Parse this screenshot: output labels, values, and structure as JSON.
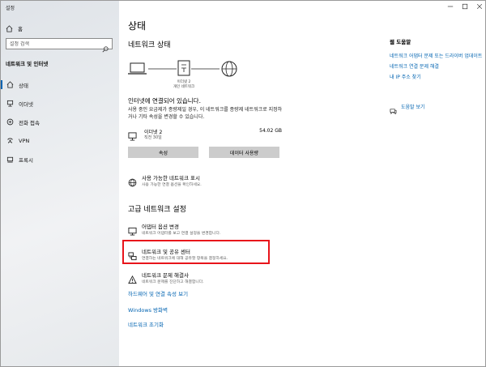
{
  "app": {
    "title": "설정"
  },
  "sidebar": {
    "home_label": "홈",
    "search_placeholder": "설정 검색",
    "section_title": "네트워크 및 인터넷",
    "items": [
      {
        "label": "상태",
        "icon": "home-network-icon",
        "active": true
      },
      {
        "label": "이더넷",
        "icon": "ethernet-icon",
        "active": false
      },
      {
        "label": "전화 접속",
        "icon": "dialup-icon",
        "active": false
      },
      {
        "label": "VPN",
        "icon": "vpn-icon",
        "active": false
      },
      {
        "label": "프록시",
        "icon": "proxy-icon",
        "active": false
      }
    ]
  },
  "main": {
    "title": "상태",
    "network_status_heading": "네트워크 상태",
    "diagram": {
      "adapter_name": "이더넷 2",
      "network_label": "개인 네트워크"
    },
    "connected_text": "인터넷에 연결되어 있습니다.",
    "description": "사용 중인 요금제가 종량제일 경우, 이 네트워크를 종량제 네트워크로 지정하거나 기타 속성을 변경할 수 있습니다.",
    "adapter": {
      "name": "이더넷 2",
      "sub": "직전 30일",
      "usage": "54.02 GB"
    },
    "buttons": {
      "properties": "속성",
      "data_usage": "데이터 사용량"
    },
    "show_networks": {
      "title": "사용 가능한 네트워크 표시",
      "sub": "사용 가능한 연결 옵션을 확인하세요."
    },
    "advanced_heading": "고급 네트워크 설정",
    "advanced_items": [
      {
        "title": "어댑터 옵션 변경",
        "sub": "네트워크 어댑터를 보고 연결 설정을 변경합니다."
      },
      {
        "title": "네트워크 및 공유 센터",
        "sub": "연결하는 네트워크에 대해 공유할 항목을 결정하세요."
      },
      {
        "title": "네트워크 문제 해결사",
        "sub": "네트워크 문제를 진단하고 해결합니다."
      }
    ],
    "links": [
      "하드웨어 및 연결 속성 보기",
      "Windows 방화벽",
      "네트워크 초기화"
    ]
  },
  "help": {
    "title": "웹 도움말",
    "links": [
      "네트워크 어댑터 문제 또는 드라이버 업데이트",
      "네트워크 연결 문제 해결",
      "내 IP 주소 찾기"
    ],
    "feedback": "도움말 보기"
  },
  "colors": {
    "accent": "#0063b1",
    "highlight": "#e8141b",
    "button": "#cccccc"
  }
}
